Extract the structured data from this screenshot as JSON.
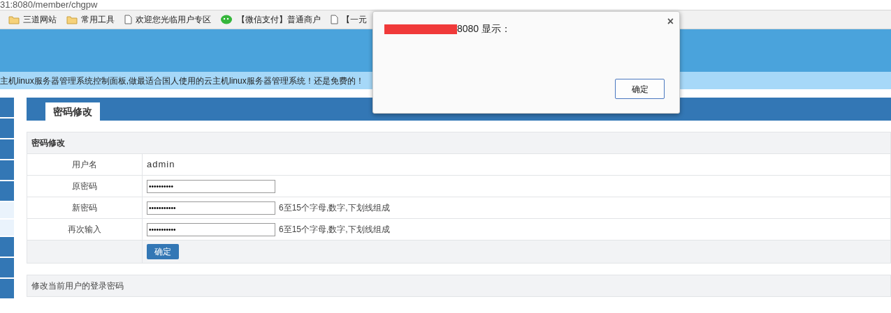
{
  "address_bar": {
    "url": "31:8080/member/chgpw"
  },
  "bookmarks": [
    {
      "kind": "folder",
      "label": "三道网站"
    },
    {
      "kind": "folder",
      "label": "常用工具"
    },
    {
      "kind": "page",
      "label": "欢迎您光临用户专区"
    },
    {
      "kind": "wechat",
      "label": "【微信支付】普通商户"
    },
    {
      "kind": "page",
      "label": "【一元"
    }
  ],
  "banner": {
    "text": "主机linux服务器管理系统控制面板,做最适合国人使用的云主机linux服务器管理系统！还是免费的！"
  },
  "sidebar": {
    "items": [
      {
        "selected": false
      },
      {
        "selected": false
      },
      {
        "selected": false
      },
      {
        "selected": false
      },
      {
        "selected": false
      },
      {
        "selected": true
      },
      {
        "selected": true
      },
      {
        "selected": false
      },
      {
        "selected": false
      },
      {
        "selected": false
      }
    ]
  },
  "tabs": [
    {
      "label": "密码修改",
      "selected": true
    }
  ],
  "form": {
    "title": "密码修改",
    "rows": [
      {
        "kind": "text",
        "label": "用户名",
        "value": "admin"
      },
      {
        "kind": "password",
        "label": "原密码",
        "value": "••••••••••"
      },
      {
        "kind": "password",
        "label": "新密码",
        "value": "•••••••••••",
        "hint": "6至15个字母,数字,下划线组成"
      },
      {
        "kind": "password",
        "label": "再次输入",
        "value": "•••••••••••",
        "hint": "6至15个字母,数字,下划线组成"
      }
    ],
    "submit": "确定"
  },
  "note": "修改当前用户的登录密码",
  "dialog": {
    "title": "8080 显示：",
    "close": "×",
    "ok": "确定"
  }
}
